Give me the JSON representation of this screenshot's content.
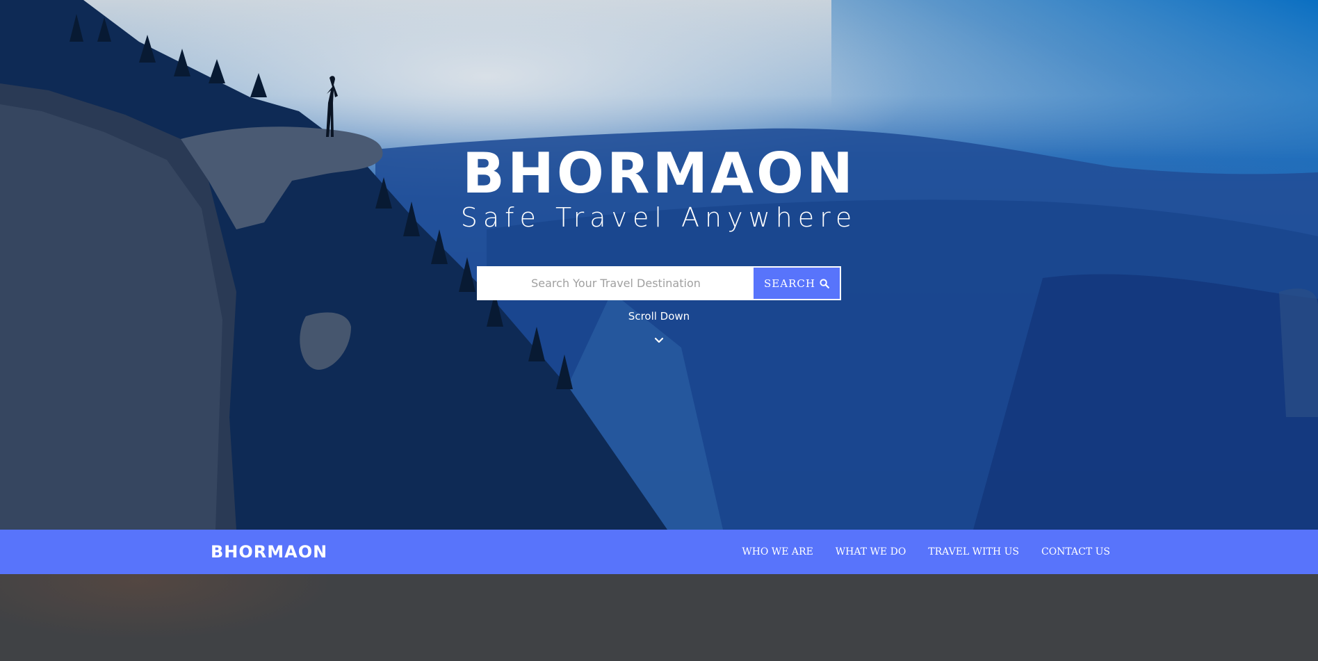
{
  "hero": {
    "title": "BHORMAON",
    "tagline": "Safe Travel Anywhere",
    "search": {
      "placeholder": "Search Your Travel Destination",
      "button_label": "SEARCH",
      "button_icon": "search-icon"
    },
    "scroll_label": "Scroll Down",
    "scroll_icon": "chevron-down-icon"
  },
  "navbar": {
    "brand": "BHORMAON",
    "links": [
      {
        "label": "WHO WE ARE"
      },
      {
        "label": "WHAT WE DO"
      },
      {
        "label": "TRAVEL WITH US"
      },
      {
        "label": "CONTACT US"
      }
    ],
    "background": "#5874fb"
  },
  "colors": {
    "accent": "#5874fb",
    "text_on_dark": "#ffffff"
  }
}
